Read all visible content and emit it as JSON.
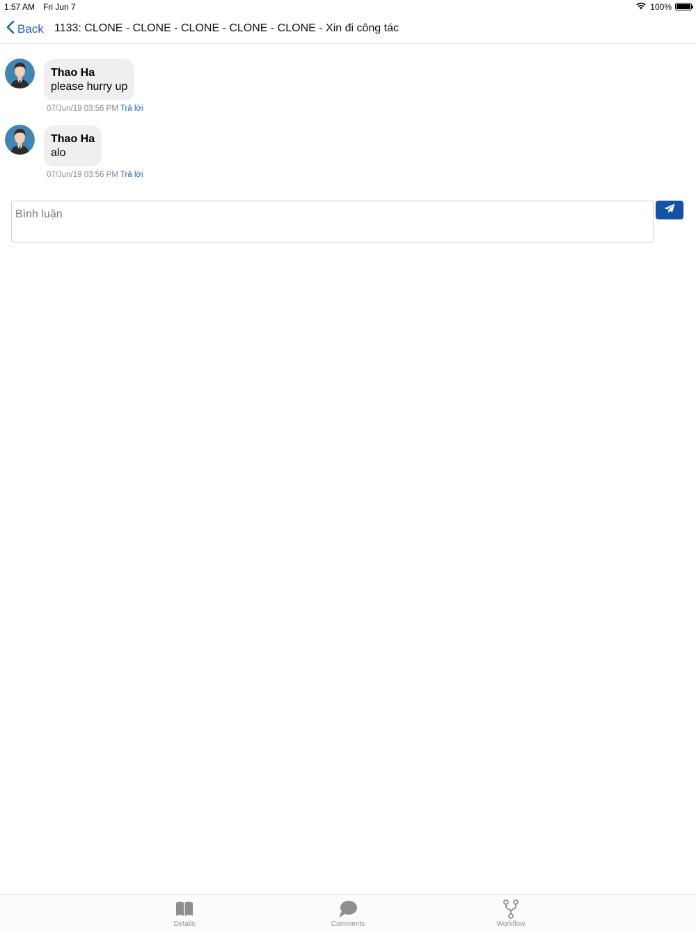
{
  "status_bar": {
    "time": "1:57 AM",
    "date": "Fri Jun 7",
    "battery": "100%",
    "icons": [
      "wifi-icon",
      "battery-icon"
    ]
  },
  "nav": {
    "back_label": "Back",
    "title": "1133: CLONE - CLONE - CLONE - CLONE - CLONE - Xin đi công tác"
  },
  "comments": [
    {
      "author": "Thao Ha",
      "text": "please hurry up",
      "timestamp": "07/Jun/19 03:56 PM",
      "reply_label": "Trả lời"
    },
    {
      "author": "Thao Ha",
      "text": "alo",
      "timestamp": "07/Jun/19 03:56 PM",
      "reply_label": "Trả lời"
    }
  ],
  "composer": {
    "placeholder": "Bình luận",
    "value": "",
    "send_icon": "paper-plane-icon"
  },
  "tabs": [
    {
      "label": "Details",
      "icon": "book-icon"
    },
    {
      "label": "Comments",
      "icon": "comment-icon"
    },
    {
      "label": "Workflow",
      "icon": "workflow-icon"
    }
  ],
  "colors": {
    "accent": "#1e5fb3",
    "send_button": "#1452a8",
    "bubble": "#efefef",
    "avatar_bg": "#3f86b5"
  }
}
